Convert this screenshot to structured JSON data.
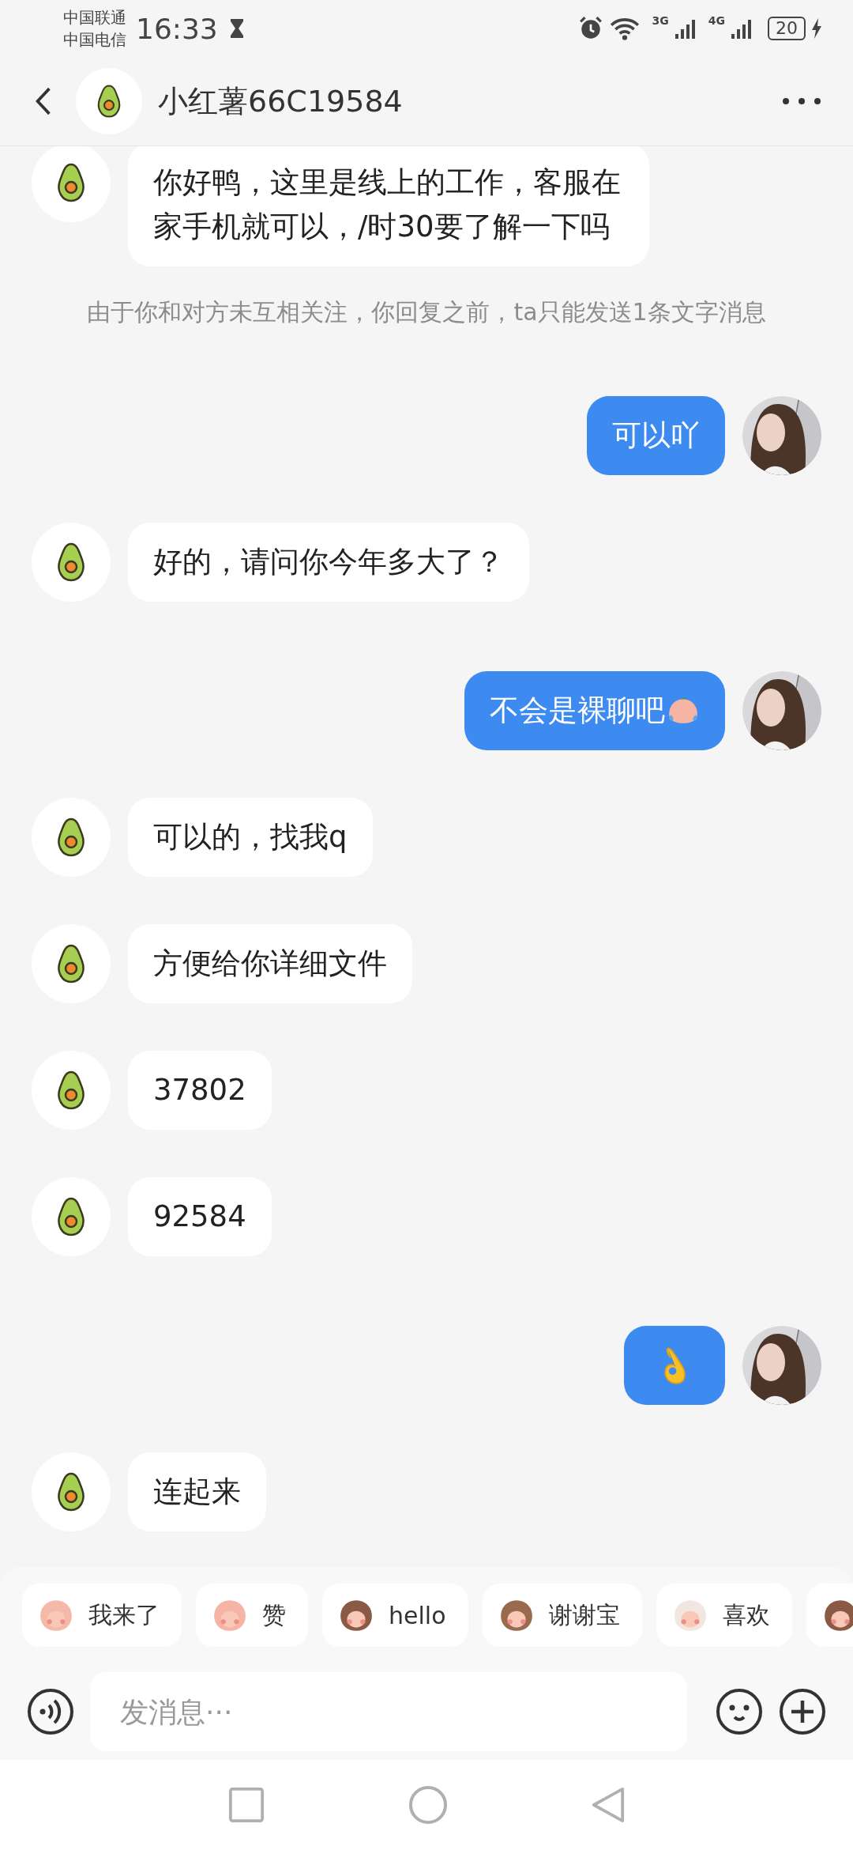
{
  "status_bar": {
    "carriers": [
      "中国联通",
      "中国电信"
    ],
    "time": "16:33",
    "network_labels": [
      "3G",
      "4G"
    ],
    "battery": "20",
    "charging": true
  },
  "header": {
    "title": "小红薯66C19584"
  },
  "messages": [
    {
      "outgoing": false,
      "kind": "text",
      "text": "你好鸭，这里是线上的工作，客服在家手机就可以，/时30要了解一下吗"
    },
    {
      "kind": "notice",
      "text": "由于你和对方未互相关注，你回复之前，ta只能发送1条文字消息"
    },
    {
      "outgoing": true,
      "kind": "text",
      "text": "可以吖"
    },
    {
      "outgoing": false,
      "kind": "text",
      "text": "好的，请问你今年多大了？"
    },
    {
      "outgoing": true,
      "kind": "text_sticker",
      "text": "不会是裸聊吧"
    },
    {
      "outgoing": false,
      "kind": "text",
      "text": "可以的，找我q"
    },
    {
      "outgoing": false,
      "kind": "text",
      "text": "方便给你详细文件"
    },
    {
      "outgoing": false,
      "kind": "text",
      "text": "37802"
    },
    {
      "outgoing": false,
      "kind": "text",
      "text": "92584"
    },
    {
      "outgoing": true,
      "kind": "sticker"
    },
    {
      "outgoing": false,
      "kind": "text",
      "text": "连起来"
    }
  ],
  "quick_replies": [
    {
      "kind": "labeled",
      "label": "我来了"
    },
    {
      "kind": "labeled",
      "label": "赞"
    },
    {
      "kind": "labeled",
      "label": "hello"
    },
    {
      "kind": "labeled",
      "label": "谢谢宝"
    },
    {
      "kind": "labeled",
      "label": "喜欢"
    },
    {
      "kind": "sticker_only"
    }
  ],
  "composer": {
    "placeholder": "发消息···"
  }
}
